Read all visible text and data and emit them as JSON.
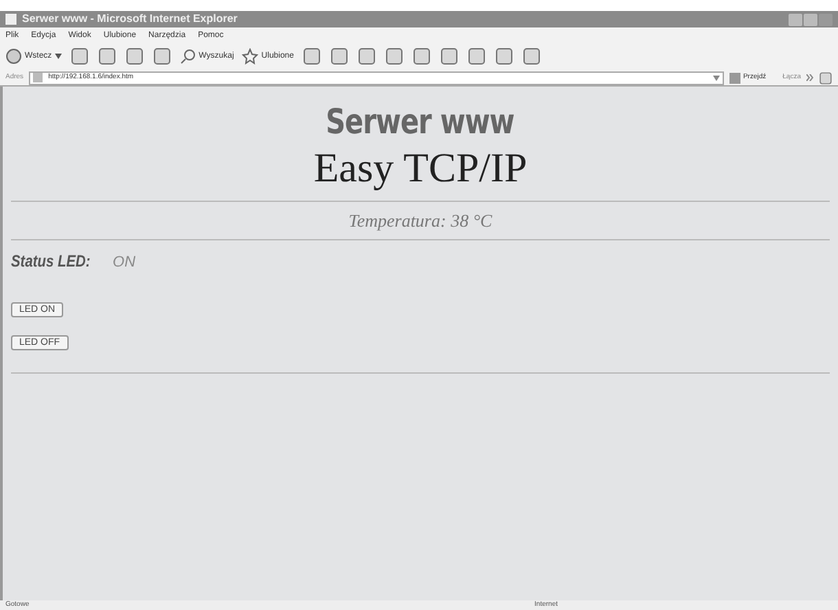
{
  "window": {
    "title": "Serwer www - Microsoft Internet Explorer"
  },
  "menu": [
    "Plik",
    "Edycja",
    "Widok",
    "Ulubione",
    "Narzędzia",
    "Pomoc"
  ],
  "toolbar": {
    "back": "Wstecz",
    "search": "Wyszukaj",
    "favorites": "Ulubione"
  },
  "address_bar": {
    "label": "Adres",
    "value": "http://192.168.1.6/index.htm",
    "go": "Przejdź",
    "links": "Łącza"
  },
  "page": {
    "heading": "Serwer www",
    "subheading": "Easy TCP/IP",
    "temperature": "Temperatura: 38 °C",
    "status_label": "Status LED:",
    "status_value": "ON",
    "buttons": [
      "LED ON",
      "LED OFF"
    ]
  },
  "status_bar": {
    "text": "Gotowe",
    "zone": "Internet"
  }
}
